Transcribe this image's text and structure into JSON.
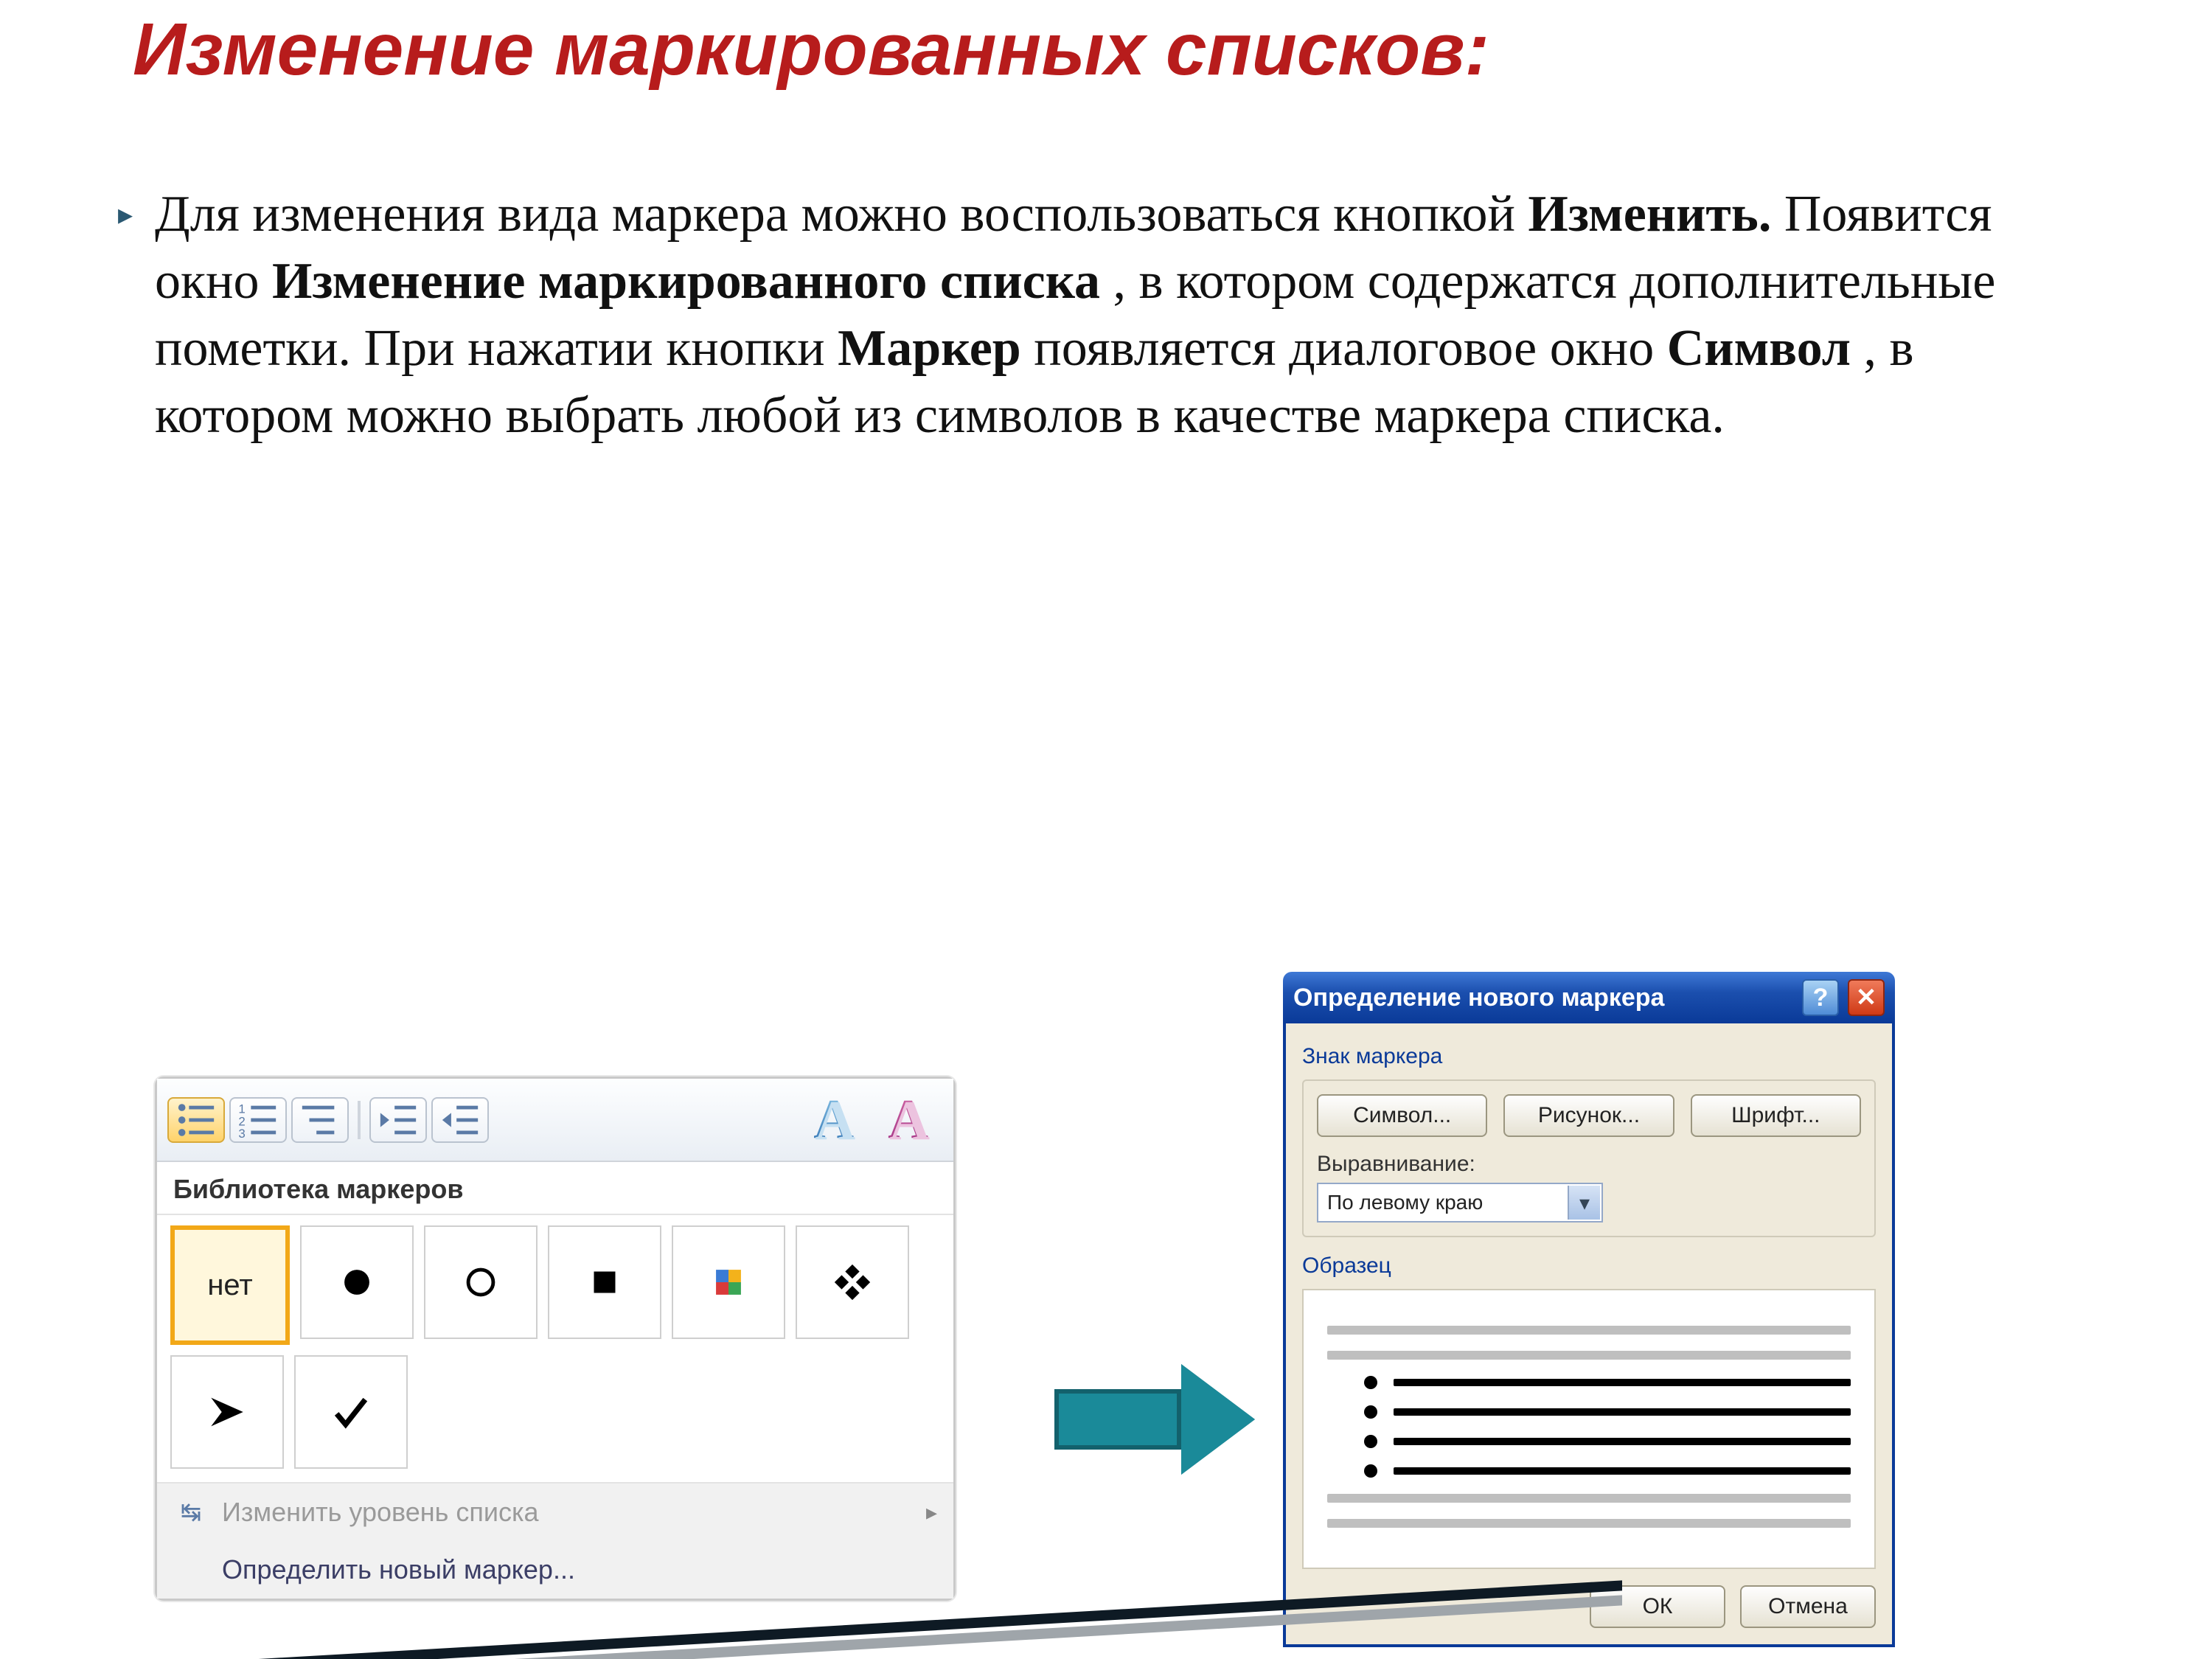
{
  "title": "Изменение маркированных списков:",
  "para": {
    "t1": "Для изменения вида маркера можно воспользоваться кнопкой ",
    "b1": "Изменить.",
    "t2": " Появится окно ",
    "b2": "Изменение маркированного списка",
    "t3": ", в котором содержатся дополнительные пометки. При нажатии кнопки ",
    "b3": "Маркер",
    "t4": " появляется диалоговое окно ",
    "b4": "Символ",
    "t5": ", в котором можно выбрать любой из символов в качестве маркера списка."
  },
  "library": {
    "title": "Библиотека маркеров",
    "none_label": "нет",
    "menu_level": "Изменить уровень списка",
    "menu_define": "Определить новый маркер..."
  },
  "dialog": {
    "title": "Определение нового маркера",
    "group_marker": "Знак маркера",
    "btn_symbol": "Символ...",
    "btn_picture": "Рисунок...",
    "btn_font": "Шрифт...",
    "align_label": "Выравнивание:",
    "align_value": "По левому краю",
    "group_preview": "Образец",
    "ok": "ОК",
    "cancel": "Отмена"
  }
}
